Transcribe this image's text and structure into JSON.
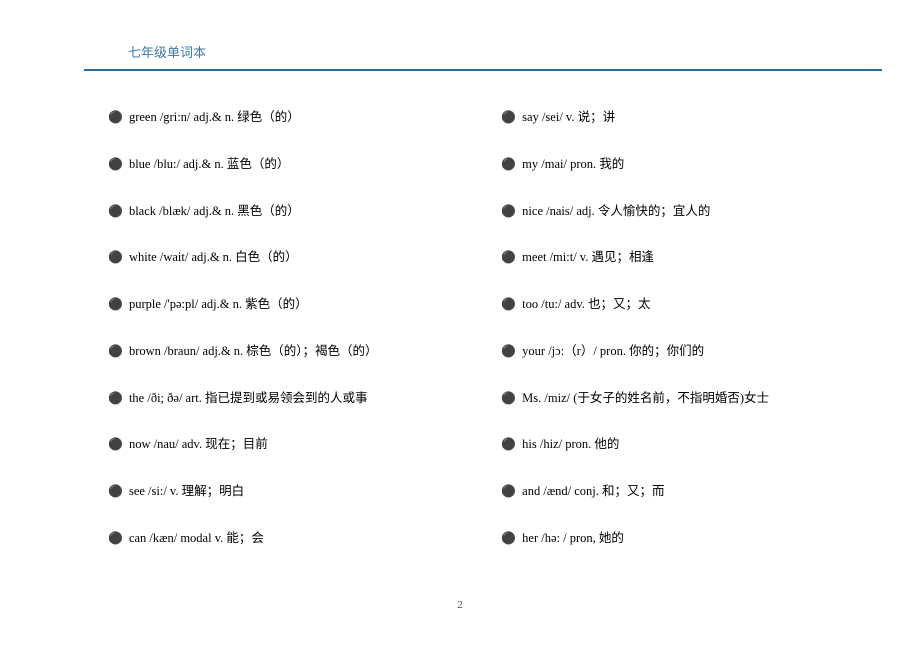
{
  "header": {
    "title": "七年级单词本"
  },
  "vocabulary": {
    "left": [
      "green /gri:n/ adj.& n.  绿色（的）",
      "blue /blu:/ adj.& n.  蓝色（的）",
      "black /blæk/ adj.& n.  黑色（的）",
      "white /wait/ adj.& n.  白色（的）",
      "purple /'pə:pl/ adj.& n.  紫色（的）",
      "brown /braun/ adj.& n.  棕色（的）；褐色（的）",
      "the /ði; ðə/ art.  指已提到或易领会到的人或事",
      "now /nau/ adv.  现在；目前",
      "see /si:/ v.  理解；明白",
      "can /kæn/ modal v.  能；会"
    ],
    "right": [
      "say /sei/ v.  说；讲",
      "my /mai/ pron.  我的",
      "nice /nais/ adj.  令人愉快的；宜人的",
      "meet /mi:t/ v.  遇见；相逢",
      "too /tu:/ adv.  也；又；太",
      "your /jɔ:（r）/ pron.  你的；你们的",
      "Ms. /miz/  (于女子的姓名前，不指明婚否)女士",
      "his /hiz/ pron.  他的",
      "and /ænd/ conj.  和；又；而",
      "her /hə: / pron,  她的"
    ]
  },
  "pageNumber": "2"
}
